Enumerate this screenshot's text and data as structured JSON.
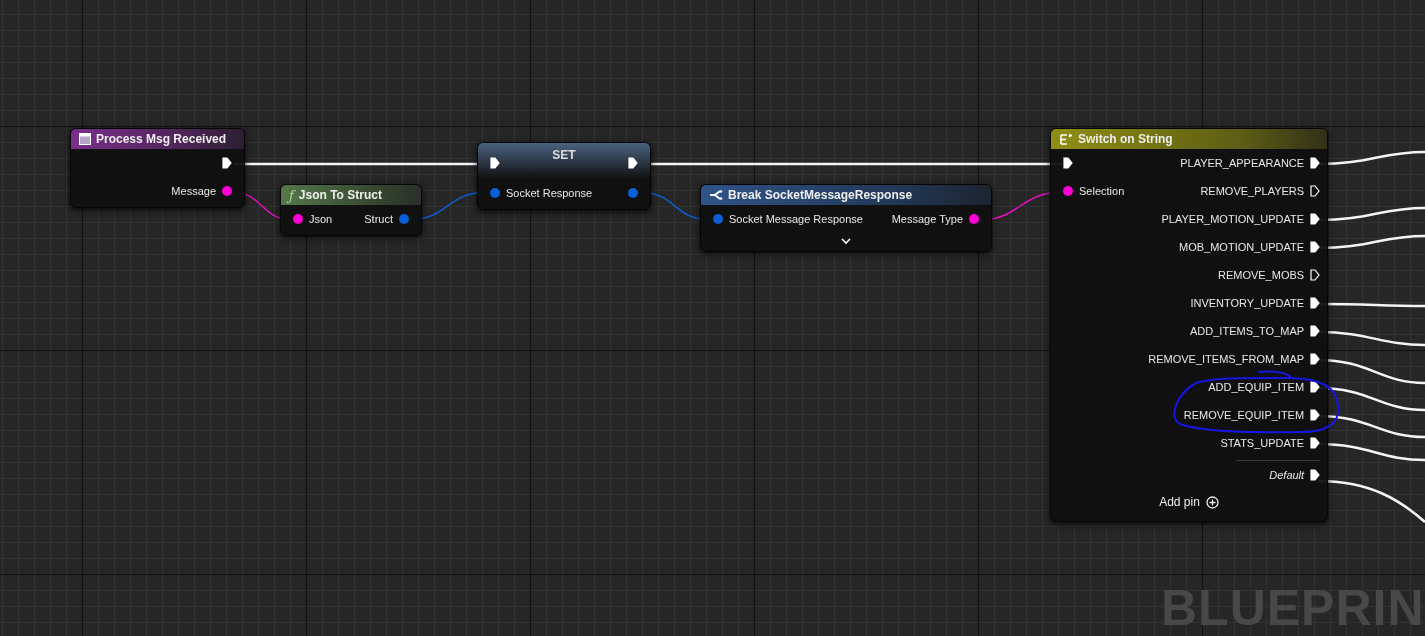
{
  "nodes": [
    {
      "kind": "event",
      "title": "Process Msg Received",
      "exec_out": {
        "connected": true
      },
      "outputs": [
        {
          "label": "Message",
          "color": "#ff00d4"
        }
      ]
    },
    {
      "kind": "function",
      "title": "Json To Struct",
      "icon_text": "ƒ",
      "inputs": [
        {
          "label": "Json",
          "color": "#ff00d4"
        }
      ],
      "outputs": [
        {
          "label": "Struct",
          "color": "#0a5fd6"
        }
      ]
    },
    {
      "kind": "set",
      "title": "SET",
      "exec_in": {
        "connected": true
      },
      "exec_out": {
        "connected": true
      },
      "inputs": [
        {
          "label": "Socket Response",
          "color": "#0a5fd6"
        }
      ],
      "outputs": [
        {
          "color": "#0a5fd6"
        }
      ]
    },
    {
      "kind": "break",
      "title": "Break SocketMessageResponse",
      "inputs": [
        {
          "label": "Socket Message Response",
          "color": "#0a5fd6"
        }
      ],
      "outputs": [
        {
          "label": "Message Type",
          "color": "#ff00d4"
        }
      ]
    },
    {
      "kind": "switch",
      "title": "Switch on String",
      "exec_in": {
        "connected": true
      },
      "inputs": [
        {
          "label": "Selection",
          "color": "#ff00d4"
        }
      ],
      "cases": [
        {
          "label": "PLAYER_APPEARANCE",
          "connected": true
        },
        {
          "label": "REMOVE_PLAYERS",
          "connected": false
        },
        {
          "label": "PLAYER_MOTION_UPDATE",
          "connected": true
        },
        {
          "label": "MOB_MOTION_UPDATE",
          "connected": true
        },
        {
          "label": "REMOVE_MOBS",
          "connected": false
        },
        {
          "label": "INVENTORY_UPDATE",
          "connected": true
        },
        {
          "label": "ADD_ITEMS_TO_MAP",
          "connected": true
        },
        {
          "label": "REMOVE_ITEMS_FROM_MAP",
          "connected": true
        },
        {
          "label": "ADD_EQUIP_ITEM",
          "connected": true
        },
        {
          "label": "REMOVE_EQUIP_ITEM",
          "connected": true
        },
        {
          "label": "STATS_UPDATE",
          "connected": true
        }
      ],
      "default": {
        "label": "Default",
        "connected": true
      },
      "add_pin": "Add pin"
    }
  ],
  "canvas_label": "BLUEPRIN"
}
